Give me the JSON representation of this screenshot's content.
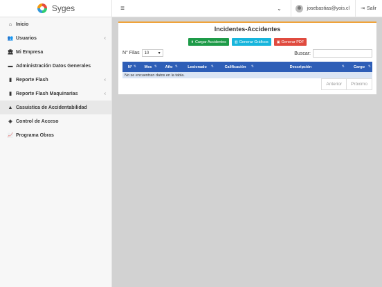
{
  "app": {
    "name": "Syges"
  },
  "header": {
    "menu_icon": "hamburger-icon",
    "user": "josebastias@yois.cl",
    "logout": "Salir"
  },
  "sidebar": {
    "items": [
      {
        "label": "Inicio",
        "icon": "home-icon",
        "has_arrow": false,
        "active": false
      },
      {
        "label": "Usuarios",
        "icon": "users-icon",
        "has_arrow": true,
        "active": false
      },
      {
        "label": "Mi Empresa",
        "icon": "bank-icon",
        "has_arrow": false,
        "active": false
      },
      {
        "label": "Administración Datos Generales",
        "icon": "briefcase-icon",
        "has_arrow": false,
        "active": false
      },
      {
        "label": "Reporte Flash",
        "icon": "file-icon",
        "has_arrow": true,
        "active": false
      },
      {
        "label": "Reporte Flash Maquinarias",
        "icon": "file-icon",
        "has_arrow": true,
        "active": false
      },
      {
        "label": "Casuistica de Accidentabilidad",
        "icon": "warning-icon",
        "has_arrow": false,
        "active": true
      },
      {
        "label": "Control de Acceso",
        "icon": "tag-icon",
        "has_arrow": false,
        "active": false
      },
      {
        "label": "Programa Obras",
        "icon": "line-chart-icon",
        "has_arrow": false,
        "active": false
      }
    ]
  },
  "main": {
    "title": "Incidentes-Accidentes",
    "buttons": {
      "upload": "Cargar Accidentes",
      "charts": "Generar Gráficos",
      "pdf": "Generar PDF"
    },
    "rows_label": "N° Filas",
    "rows_value": "10",
    "search_label": "Buscar:",
    "search_value": "",
    "columns": [
      "N°",
      "Mes",
      "Año",
      "Lesionado",
      "Calificación",
      "Descripción",
      "Cargo"
    ],
    "empty_message": "No se encuentran datos en la tabla.",
    "pager": {
      "prev": "Anterior",
      "next": "Próximo"
    }
  },
  "colors": {
    "accent_top_border": "#f0a33a",
    "table_header": "#2e5eb7",
    "btn_green": "#1e9b48",
    "btn_cyan": "#17b5dc",
    "btn_red": "#e04b3f"
  }
}
